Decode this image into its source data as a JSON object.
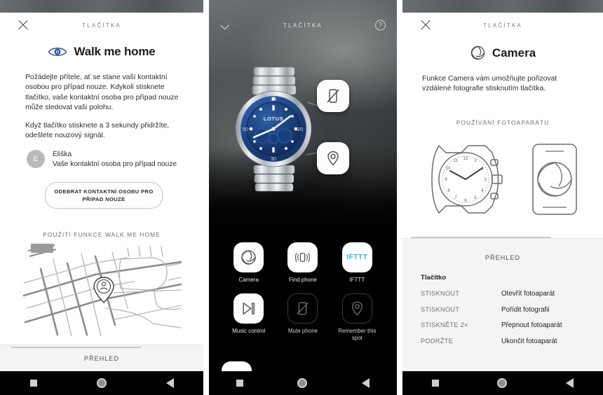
{
  "screen_title": "TLAČÍTKA",
  "panel1": {
    "close_icon": "close-icon",
    "feature_icon": "eye-icon",
    "feature_title": "Walk me home",
    "paragraph1": "Požádejte přítele, ať se stane vaší kontaktní osobou pro případ nouze. Kdykoli stisknete tlačítko, vaše kontaktní osoba pro případ nouze může sledovat vaši polohu.",
    "paragraph2": "Když tlačítko stisknete a 3 sekundy přidržíte, odešlete nouzový signál.",
    "contact": {
      "avatar_initial": "E",
      "name": "Eliška",
      "role": "Vaše kontaktní osoba pro případ nouze"
    },
    "remove_button": "ODEBRAT KONTAKTNÍ OSOBU PRO PŘÍPAD NOUZE",
    "map_caption": "POUŽITÍ FUNKCE WALK ME HOME",
    "map_pin_icon": "person-pin-icon",
    "overview_label": "PŘEHLED"
  },
  "panel2": {
    "back_icon": "chevron-left-icon",
    "help_icon": "help-circle-icon",
    "watch_brand": "LOTUS",
    "floating_buttons": [
      {
        "name": "mute-phone-button",
        "icon": "phone-mute-icon"
      },
      {
        "name": "remember-spot-button",
        "icon": "location-pin-icon"
      }
    ],
    "apps": [
      {
        "label": "Camera",
        "icon": "shutter-icon",
        "active": true
      },
      {
        "label": "Find phone",
        "icon": "phone-ring-icon",
        "active": true
      },
      {
        "label": "IFTTT",
        "icon": "ifttt-logo",
        "logo_text": "IFTTT",
        "active": true
      },
      {
        "label": "Music control",
        "icon": "play-next-icon",
        "active": true
      },
      {
        "label": "Mute phone",
        "icon": "phone-mute-icon",
        "active": false
      },
      {
        "label": "Remember this spot",
        "icon": "location-pin-icon",
        "active": false
      }
    ]
  },
  "panel3": {
    "close_icon": "close-icon",
    "feature_icon": "shutter-icon",
    "feature_title": "Camera",
    "paragraph1": "Funkce Camera vám umožňujte pořizovat vzdálené fotografie stisknutím tlačítka.",
    "usage_caption": "POUŽÍVÁNÍ FOTOAPARÁTU",
    "illustration": {
      "watch_icon": "analog-watch-icon",
      "phone_icon": "phone-shutter-icon"
    },
    "overview_label": "PŘEHLED",
    "table": {
      "header": "Tlačítko",
      "rows": [
        {
          "key": "STISKNOUT",
          "value": "Otevřít fotoaparát"
        },
        {
          "key": "STISKNOUT",
          "value": "Pořídit fotografii"
        },
        {
          "key": "STISKNĚTE 2×",
          "value": "Přepnout fotoaparát"
        },
        {
          "key": "PODRŽTE",
          "value": "Ukončit fotoaparát"
        }
      ]
    }
  },
  "navbar": {
    "recents_icon": "square-recents-icon",
    "home_icon": "circle-home-icon",
    "back_icon": "triangle-back-icon"
  },
  "colors": {
    "accent_blue": "#2f4e9e",
    "ifttt_blue": "#33b1f0",
    "dark_bg": "#000000"
  }
}
